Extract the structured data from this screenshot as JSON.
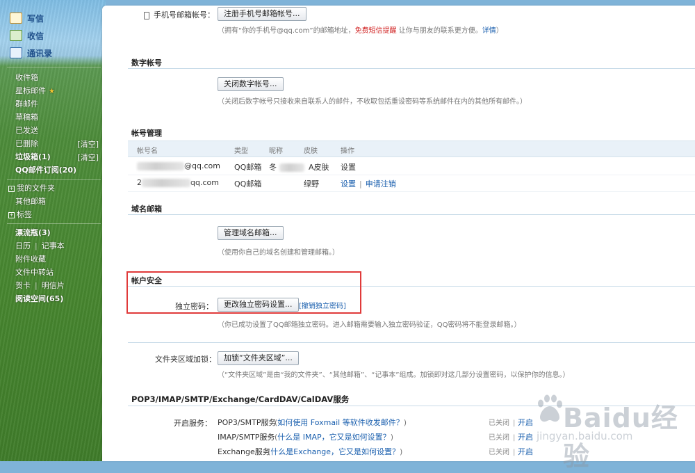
{
  "sidebar": {
    "top": [
      {
        "label": "写信",
        "icon": "pen-icon"
      },
      {
        "label": "收信",
        "icon": "inbox-icon"
      },
      {
        "label": "通讯录",
        "icon": "contacts-icon"
      }
    ],
    "folders": {
      "inbox": "收件箱",
      "starred": "星标邮件",
      "groups": "群邮件",
      "drafts": "草稿箱",
      "sent": "已发送",
      "deleted": "已删除",
      "deleted_action": "[清空]",
      "spam": "垃圾箱(1)",
      "spam_action": "[清空]",
      "qq_subscribe": "QQ邮件订阅(20)"
    },
    "my_folders": "我的文件夹",
    "other_mailbox": "其他邮箱",
    "tags": "标签",
    "tools": {
      "bottle": "漂流瓶(3)",
      "calendar": "日历",
      "notes": "记事本",
      "attachments": "附件收藏",
      "transfer": "文件中转站",
      "cards": "贺卡",
      "postcards": "明信片",
      "reading": "阅读空间(65)"
    }
  },
  "phone_email": {
    "label": "手机号邮箱帐号：",
    "button": "注册手机号邮箱帐号...",
    "desc_a": "（拥有“你的手机号@qq.com”的邮箱地址，",
    "desc_red": "免费短信提醒",
    "desc_b": " 让你与朋友的联系更方便。",
    "desc_link": "详情",
    "desc_end": "）"
  },
  "digital": {
    "title": "数字帐号",
    "button": "关闭数字帐号...",
    "desc": "（关闭后数字帐号只接收来自联系人的邮件，不收取包括重设密码等系统邮件在内的其他所有邮件。）"
  },
  "account_mgmt": {
    "title": "帐号管理",
    "headers": [
      "帐号名",
      "类型",
      "昵称",
      "皮肤",
      "操作"
    ],
    "rows": [
      {
        "account_suffix": "@qq.com",
        "type": "QQ邮箱",
        "nickname": "冬",
        "skin": "A皮肤",
        "actions": [
          "设置"
        ]
      },
      {
        "account_prefix": "2",
        "account_suffix": "qq.com",
        "type": "QQ邮箱",
        "nickname": "",
        "skin": "绿野",
        "actions": [
          "设置",
          "申请注销"
        ]
      }
    ]
  },
  "domain": {
    "title": "域名邮箱",
    "button": "管理域名邮箱...",
    "desc": "（使用你自己的域名创建和管理邮箱。）"
  },
  "security": {
    "title": "帐户安全",
    "label": "独立密码：",
    "button": "更改独立密码设置...",
    "link": "[撤销独立密码]",
    "desc": "（你已成功设置了QQ邮箱独立密码。进入邮箱需要输入独立密码验证，QQ密码将不能登录邮箱。）"
  },
  "folder_lock": {
    "label": "文件夹区域加锁：",
    "button": "加锁“文件夹区域”...",
    "desc": "（“文件夹区域”是由“我的文件夹”、“其他邮箱”、“记事本”组成。加锁即对这几部分设置密码，以保护你的信息。）"
  },
  "services": {
    "title": "POP3/IMAP/SMTP/Exchange/CardDAV/CalDAV服务",
    "label": "开启服务：",
    "rows": [
      {
        "name": "POP3/SMTP服务",
        "link": "如何使用 Foxmail 等软件收发邮件？",
        "status": "已关闭",
        "action": "开启"
      },
      {
        "name": "IMAP/SMTP服务",
        "link": "什么是 IMAP，它又是如何设置？",
        "status": "已关闭",
        "action": "开启"
      },
      {
        "name": "Exchange服务",
        "link": "什么是Exchange，它又是如何设置？",
        "status": "已关闭",
        "action": "开启"
      }
    ]
  },
  "watermark": {
    "text": "Baidu经验",
    "sub": "jingyan.baidu.com"
  }
}
